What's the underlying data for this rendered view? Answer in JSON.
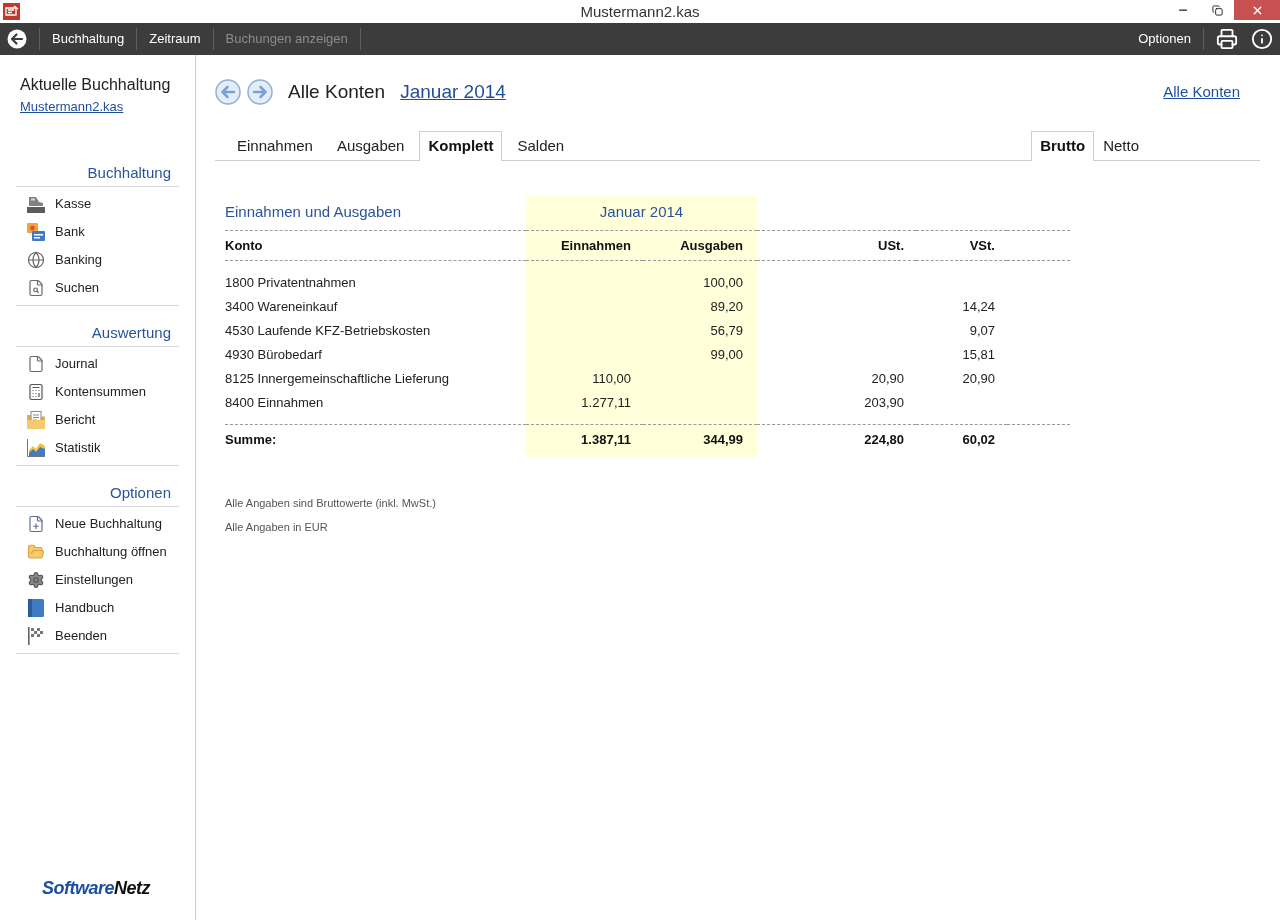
{
  "window": {
    "title": "Mustermann2.kas"
  },
  "toolbar": {
    "items": [
      {
        "label": "Buchhaltung",
        "disabled": false
      },
      {
        "label": "Zeitraum",
        "disabled": false
      },
      {
        "label": "Buchungen anzeigen",
        "disabled": true
      }
    ],
    "options": "Optionen"
  },
  "sidebar": {
    "title": "Aktuelle Buchhaltung",
    "file_link": "Mustermann2.kas",
    "sections": [
      {
        "heading": "Buchhaltung",
        "items": [
          "Kasse",
          "Bank",
          "Banking",
          "Suchen"
        ]
      },
      {
        "heading": "Auswertung",
        "items": [
          "Journal",
          "Kontensummen",
          "Bericht",
          "Statistik"
        ]
      },
      {
        "heading": "Optionen",
        "items": [
          "Neue Buchhaltung",
          "Buchhaltung öffnen",
          "Einstellungen",
          "Handbuch",
          "Beenden"
        ]
      }
    ],
    "logo": [
      "Software",
      "Netz"
    ]
  },
  "header": {
    "title": "Alle Konten",
    "period_link": "Januar 2014",
    "right_link": "Alle Konten"
  },
  "view_tabs": [
    {
      "label": "Einnahmen",
      "selected": false
    },
    {
      "label": "Ausgaben",
      "selected": false
    },
    {
      "label": "Komplett",
      "selected": true
    },
    {
      "label": "Salden",
      "selected": false
    }
  ],
  "tax_tabs": [
    {
      "label": "Brutto",
      "selected": true
    },
    {
      "label": "Netto",
      "selected": false
    }
  ],
  "report": {
    "title": "Einnahmen und Ausgaben",
    "period": "Januar 2014",
    "columns": [
      "Konto",
      "Einnahmen",
      "Ausgaben",
      "USt.",
      "VSt."
    ],
    "rows": [
      {
        "account": "1800 Privatentnahmen",
        "expenses": "100,00"
      },
      {
        "account": "3400 Wareneinkauf",
        "expenses": "89,20",
        "input_tax": "14,24"
      },
      {
        "account": "4530 Laufende KFZ-Betriebskosten",
        "expenses": "56,79",
        "input_tax": "9,07"
      },
      {
        "account": "4930 Bürobedarf",
        "expenses": "99,00",
        "input_tax": "15,81"
      },
      {
        "account": "8125 Innergemeinschaftliche Lieferung",
        "income": "110,00",
        "output_tax": "20,90",
        "input_tax": "20,90"
      },
      {
        "account": "8400 Einnahmen",
        "income": "1.277,11",
        "output_tax": "203,90"
      }
    ],
    "total": {
      "label": "Summe:",
      "income": "1.387,11",
      "expenses": "344,99",
      "output_tax": "224,80",
      "input_tax": "60,02"
    }
  },
  "notes": [
    "Alle Angaben sind Bruttowerte (inkl. MwSt.)",
    "Alle Angaben in EUR"
  ]
}
